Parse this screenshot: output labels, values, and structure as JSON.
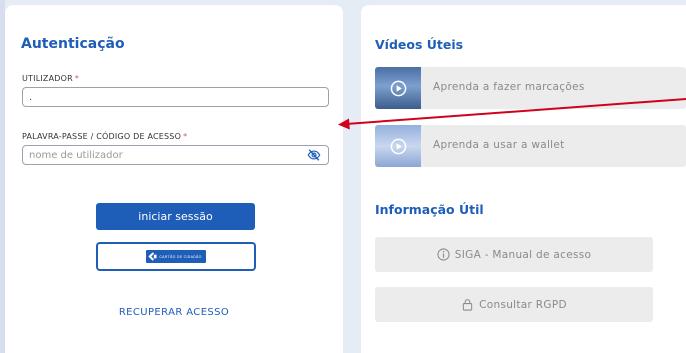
{
  "auth": {
    "title": "Autenticação",
    "user_label": "UTILIZADOR",
    "user_value": ".",
    "pass_label": "PALAVRA-PASSE / CÓDIGO DE ACESSO",
    "pass_placeholder": "nome de utilizador",
    "required_mark": "*",
    "login_button": "iniciar sessão",
    "cmd_button_text": "CARTÃO DE CIDADÃO",
    "recover_link": "RECUPERAR ACESSO"
  },
  "videos": {
    "title": "Vídeos Úteis",
    "items": [
      {
        "label": "Aprenda a fazer marcações",
        "icon": "play-icon"
      },
      {
        "label": "Aprenda a usar a wallet",
        "icon": "play-icon"
      }
    ]
  },
  "info": {
    "title": "Informação Útil",
    "items": [
      {
        "label": "SIGA - Manual de acesso",
        "icon": "info-icon"
      },
      {
        "label": "Consultar RGPD",
        "icon": "lock-icon"
      }
    ]
  },
  "colors": {
    "accent": "#1f5eb8",
    "annotation_arrow": "#d0021b",
    "muted_button": "#ececec"
  }
}
